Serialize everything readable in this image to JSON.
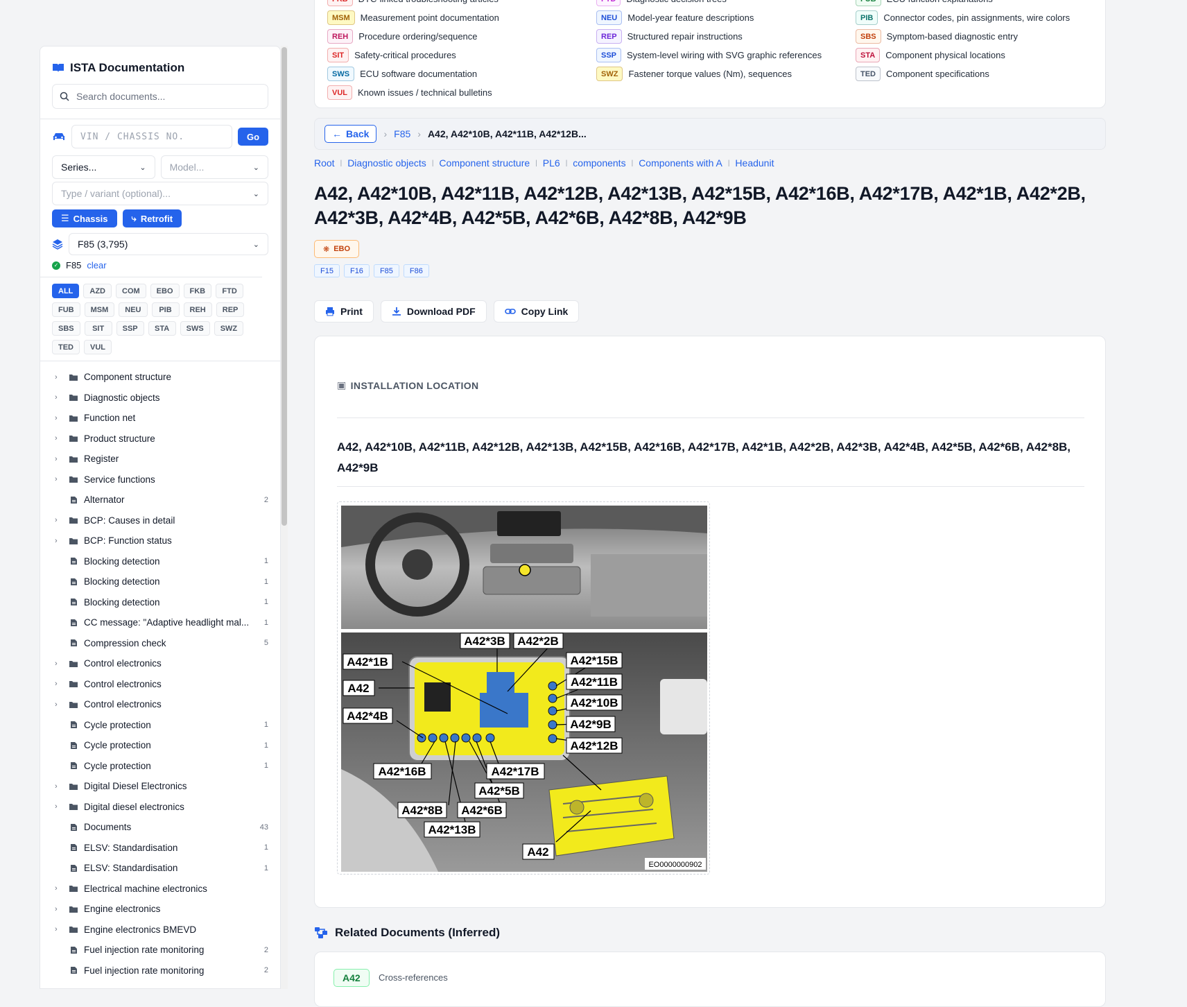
{
  "sidebar": {
    "title": "ISTA Documentation",
    "search_placeholder": "Search documents...",
    "vin_placeholder": "VIN / CHASSIS NO.",
    "go_label": "Go",
    "series_placeholder": "Series...",
    "model_placeholder": "Model...",
    "type_placeholder": "Type / variant (optional)...",
    "chassis_label": "Chassis",
    "retrofit_label": "Retrofit",
    "series_value": "F85 (3,795)",
    "active_series": "F85",
    "clear_label": "clear",
    "chips": [
      "ALL",
      "AZD",
      "COM",
      "EBO",
      "FKB",
      "FTD",
      "FUB",
      "MSM",
      "NEU",
      "PIB",
      "REH",
      "REP",
      "SBS",
      "SIT",
      "SSP",
      "STA",
      "SWS",
      "SWZ",
      "TED",
      "VUL"
    ],
    "tree": [
      {
        "label": "Component structure",
        "folder": true,
        "count": ""
      },
      {
        "label": "Diagnostic objects",
        "folder": true,
        "count": ""
      },
      {
        "label": "Function net",
        "folder": true,
        "count": ""
      },
      {
        "label": "Product structure",
        "folder": true,
        "count": ""
      },
      {
        "label": "Register",
        "folder": true,
        "count": ""
      },
      {
        "label": "Service functions",
        "folder": true,
        "count": ""
      },
      {
        "label": "Alternator",
        "folder": false,
        "count": "2"
      },
      {
        "label": "BCP: Causes in detail",
        "folder": true,
        "count": ""
      },
      {
        "label": "BCP: Function status",
        "folder": true,
        "count": ""
      },
      {
        "label": "Blocking detection",
        "folder": false,
        "count": "1"
      },
      {
        "label": "Blocking detection",
        "folder": false,
        "count": "1"
      },
      {
        "label": "Blocking detection",
        "folder": false,
        "count": "1"
      },
      {
        "label": "CC message: \"Adaptive headlight mal...",
        "folder": false,
        "count": "1"
      },
      {
        "label": "Compression check",
        "folder": false,
        "count": "5"
      },
      {
        "label": "Control electronics",
        "folder": true,
        "count": ""
      },
      {
        "label": "Control electronics",
        "folder": true,
        "count": ""
      },
      {
        "label": "Control electronics",
        "folder": true,
        "count": ""
      },
      {
        "label": "Cycle protection",
        "folder": false,
        "count": "1"
      },
      {
        "label": "Cycle protection",
        "folder": false,
        "count": "1"
      },
      {
        "label": "Cycle protection",
        "folder": false,
        "count": "1"
      },
      {
        "label": "Digital Diesel Electronics",
        "folder": true,
        "count": ""
      },
      {
        "label": "Digital diesel electronics",
        "folder": true,
        "count": ""
      },
      {
        "label": "Documents",
        "folder": false,
        "count": "43"
      },
      {
        "label": "ELSV: Standardisation",
        "folder": false,
        "count": "1"
      },
      {
        "label": "ELSV: Standardisation",
        "folder": false,
        "count": "1"
      },
      {
        "label": "Electrical machine electronics",
        "folder": true,
        "count": ""
      },
      {
        "label": "Engine electronics",
        "folder": true,
        "count": ""
      },
      {
        "label": "Engine electronics BMEVD",
        "folder": true,
        "count": ""
      },
      {
        "label": "Fuel injection rate monitoring",
        "folder": false,
        "count": "2"
      },
      {
        "label": "Fuel injection rate monitoring",
        "folder": false,
        "count": "2"
      }
    ]
  },
  "legend": [
    {
      "code": "FKB",
      "desc": "DTC-linked troubleshooting articles",
      "color": "#dc2626",
      "bg": "#fef2f2"
    },
    {
      "code": "FTD",
      "desc": "Diagnostic decision trees",
      "color": "#c026d3",
      "bg": "#fdf4ff"
    },
    {
      "code": "FUB",
      "desc": "ECU function explanations",
      "color": "#15803d",
      "bg": "#f0fdf4"
    },
    {
      "code": "MSM",
      "desc": "Measurement point documentation",
      "color": "#a16207",
      "bg": "#fef9c3"
    },
    {
      "code": "NEU",
      "desc": "Model-year feature descriptions",
      "color": "#1d4ed8",
      "bg": "#eff6ff"
    },
    {
      "code": "PIB",
      "desc": "Connector codes, pin assignments, wire colors",
      "color": "#0f766e",
      "bg": "#f0fdfa"
    },
    {
      "code": "REH",
      "desc": "Procedure ordering/sequence",
      "color": "#be185d",
      "bg": "#fdf2f8"
    },
    {
      "code": "REP",
      "desc": "Structured repair instructions",
      "color": "#6d28d9",
      "bg": "#f5f3ff"
    },
    {
      "code": "SBS",
      "desc": "Symptom-based diagnostic entry",
      "color": "#c2410c",
      "bg": "#fff7ed"
    },
    {
      "code": "SIT",
      "desc": "Safety-critical procedures",
      "color": "#dc2626",
      "bg": "#fef2f2"
    },
    {
      "code": "SSP",
      "desc": "System-level wiring with SVG graphic references",
      "color": "#1d4ed8",
      "bg": "#eff6ff"
    },
    {
      "code": "STA",
      "desc": "Component physical locations",
      "color": "#be123c",
      "bg": "#fff1f2"
    },
    {
      "code": "SWS",
      "desc": "ECU software documentation",
      "color": "#0369a1",
      "bg": "#f0f9ff"
    },
    {
      "code": "SWZ",
      "desc": "Fastener torque values (Nm), sequences",
      "color": "#a16207",
      "bg": "#fef9c3"
    },
    {
      "code": "TED",
      "desc": "Component specifications",
      "color": "#475569",
      "bg": "#f8fafc"
    },
    {
      "code": "VUL",
      "desc": "Known issues / technical bulletins",
      "color": "#dc2626",
      "bg": "#fef2f2"
    }
  ],
  "nav": {
    "back_label": "Back",
    "crumb_series": "F85",
    "crumb_current": "A42, A42*10B, A42*11B, A42*12B...",
    "breadcrumb": [
      "Root",
      "Diagnostic objects",
      "Component structure",
      "PL6",
      "components",
      "Components with A",
      "Headunit"
    ]
  },
  "doc": {
    "title": "A42, A42*10B, A42*11B, A42*12B, A42*13B, A42*15B, A42*16B, A42*17B, A42*1B, A42*2B, A42*3B, A42*4B, A42*5B, A42*6B, A42*8B, A42*9B",
    "type_badge": "EBO",
    "models": [
      "F15",
      "F16",
      "F85",
      "F86"
    ],
    "actions": {
      "print": "Print",
      "pdf": "Download PDF",
      "copy": "Copy Link"
    },
    "section_label": "INSTALLATION LOCATION",
    "section_title": "A42, A42*10B, A42*11B, A42*12B, A42*13B, A42*15B, A42*16B, A42*17B, A42*1B, A42*2B, A42*3B, A42*4B, A42*5B, A42*6B, A42*8B, A42*9B",
    "figure_code": "EO0000000902",
    "figure_labels": [
      "A42*3B",
      "A42*2B",
      "A42*1B",
      "A42*15B",
      "A42*11B",
      "A42",
      "A42*10B",
      "A42*4B",
      "A42*9B",
      "A42*12B",
      "A42*16B",
      "A42*17B",
      "A42*5B",
      "A42*8B",
      "A42*6B",
      "A42*13B",
      "A42"
    ]
  },
  "related": {
    "heading": "Related Documents (Inferred)",
    "tag": "A42",
    "text": "Cross-references"
  }
}
